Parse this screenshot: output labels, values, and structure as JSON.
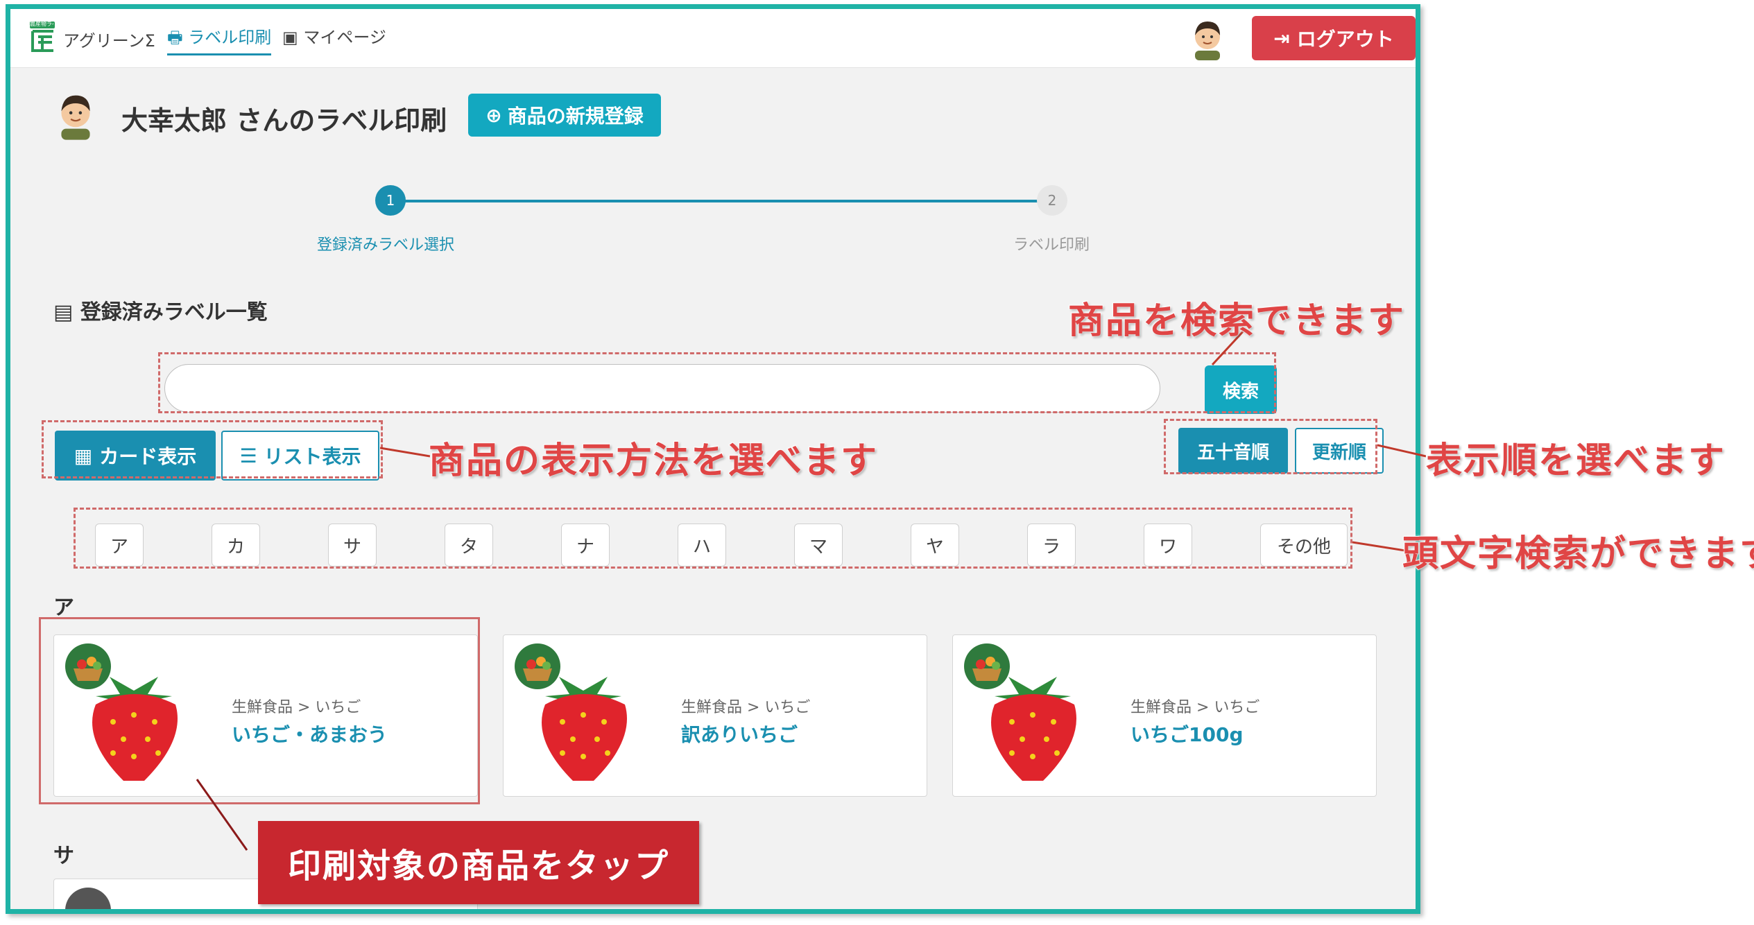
{
  "navbar": {
    "logo_badge": "農産物ラベル",
    "logo_text": "アグリーンΣ",
    "label_print": "ラベル印刷",
    "mypage": "マイページ",
    "logout": "ログアウト"
  },
  "header": {
    "title": "大幸太郎 さんのラベル印刷",
    "new_product": "商品の新規登録"
  },
  "steps": [
    {
      "num": "1",
      "label": "登録済みラベル選択"
    },
    {
      "num": "2",
      "label": "ラベル印刷"
    }
  ],
  "section_title": "登録済みラベル一覧",
  "search": {
    "placeholder": "",
    "button": "検索"
  },
  "view": {
    "card": "カード表示",
    "list": "リスト表示"
  },
  "sort": {
    "kana": "五十音順",
    "updated": "更新順"
  },
  "kana": [
    "ア",
    "カ",
    "サ",
    "タ",
    "ナ",
    "ハ",
    "マ",
    "ヤ",
    "ラ",
    "ワ",
    "その他"
  ],
  "groups": [
    {
      "head": "ア",
      "items": [
        {
          "category": "生鮮食品 > いちご",
          "name": "いちご・あまおう"
        },
        {
          "category": "生鮮食品 > いちご",
          "name": "訳ありいちご"
        },
        {
          "category": "生鮮食品 > いちご",
          "name": "いちご100g"
        }
      ]
    },
    {
      "head": "サ",
      "items": []
    }
  ],
  "annotations": {
    "search": "商品を検索できます",
    "view": "商品の表示方法を選べます",
    "sort": "表示順を選べます",
    "kana": "頭文字検索ができます",
    "tap": "印刷対象の商品をタップ"
  },
  "colors": {
    "teal": "#13a8c0",
    "nav_active": "#1a8fb0",
    "logout": "#d9404a",
    "frame": "#1fb3a6",
    "annotation": "#e04545"
  }
}
